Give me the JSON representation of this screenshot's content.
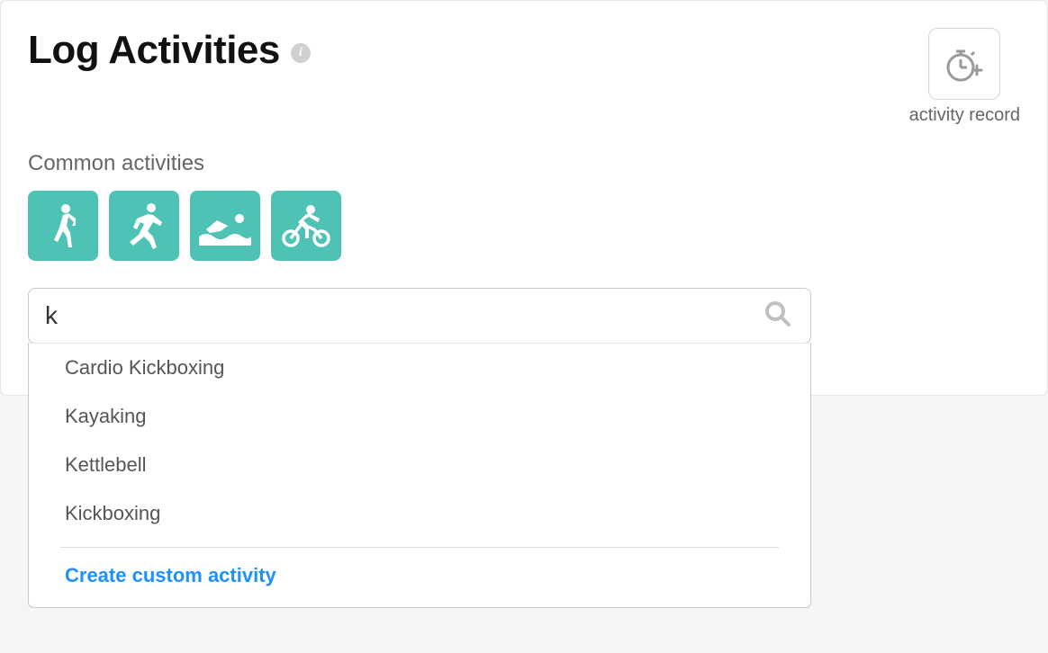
{
  "header": {
    "title": "Log Activities"
  },
  "activityRecord": {
    "label": "activity record"
  },
  "commonActivities": {
    "heading": "Common activities",
    "tiles": [
      "walk",
      "run",
      "swim",
      "bike"
    ]
  },
  "search": {
    "value": "k",
    "placeholder": ""
  },
  "suggestions": {
    "items": [
      "Cardio Kickboxing",
      "Kayaking",
      "Kettlebell",
      "Kickboxing"
    ],
    "createLabel": "Create custom activity"
  }
}
